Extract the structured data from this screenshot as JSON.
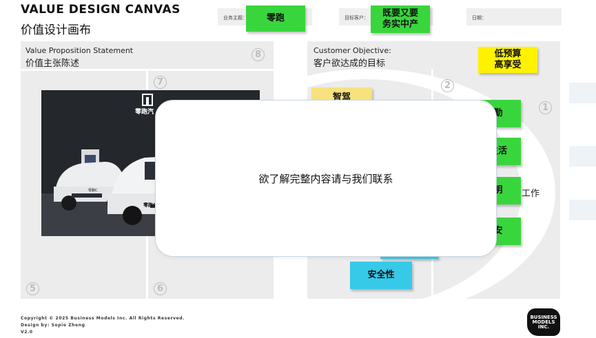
{
  "header": {
    "title_en": "VALUE DESIGN CANVAS",
    "title_zh": "价值设计画布",
    "business_label": "业务主题：",
    "target_label": "目标客户：",
    "date_label": "日期："
  },
  "stickies": {
    "business_note": "零跑",
    "target_note_line1": "既要又要",
    "target_note_line2": "务实中产",
    "objective_note_line1": "低预算",
    "objective_note_line2": "高享受",
    "lightyellow_note": "智驾",
    "green_note_1": "勤",
    "green_note_2": "生活",
    "green_note_3": "明",
    "green_note_4": "安",
    "safety_note": "安全性"
  },
  "sections": {
    "vps_title_en": "Value Proposition Statement",
    "vps_title_zh": "价值主张陈述",
    "co_title_en": "Customer Objective:",
    "co_title_zh": "客户欲达成的目标",
    "work_text": "工作",
    "num_1": "1",
    "num_2": "2",
    "num_5": "5",
    "num_6": "6",
    "num_7": "7",
    "num_8": "8"
  },
  "photo": {
    "sign_text": "零跑汽",
    "car_badge_1": "零跑C",
    "car_badge_2": "零跑C1"
  },
  "modal": {
    "message": "欲了解完整内容请与我们联系"
  },
  "footer": {
    "copyright": "Copyright © 2025 Business Models Inc. All Rights Reserved.",
    "design_by": "Design by: Sopio Zheng",
    "version": "V2.0",
    "logo_line1": "BUSINESS",
    "logo_line2": "MODELS",
    "logo_line3": "INC."
  },
  "colors": {
    "sticky_green": "#38d63c",
    "sticky_yellow": "#fff200",
    "sticky_cyan": "#37c9e8",
    "panel_gray": "#ececec"
  }
}
